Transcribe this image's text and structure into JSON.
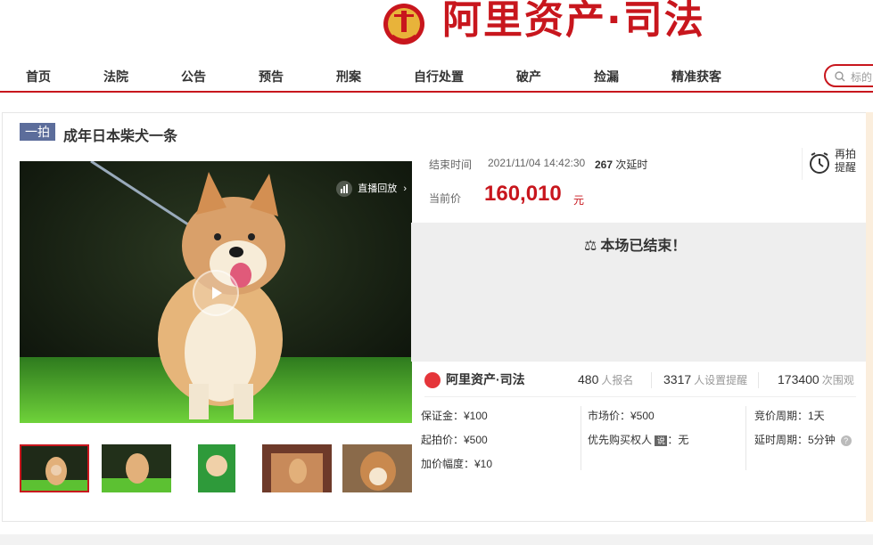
{
  "header": {
    "brand": "阿里资产·司法"
  },
  "nav": {
    "items": [
      "首页",
      "法院",
      "公告",
      "预告",
      "刑案",
      "自行处置",
      "破产",
      "捡漏",
      "精准获客"
    ],
    "search_placeholder": "标的"
  },
  "lot": {
    "badge": "一拍",
    "title": "成年日本柴犬一条",
    "replay_label": "直播回放",
    "end_time_label": "结束时间",
    "end_time": "2021/11/04 14:42:30",
    "delay_count": "267",
    "delay_suffix": "次延时",
    "current_price_label": "当前价",
    "current_price": "160,010",
    "price_unit": "元",
    "again_line1": "再拍",
    "again_line2": "提醒",
    "ended_text": "本场已结束！"
  },
  "stats": {
    "logo_text": "阿里资产·司法",
    "signups": "480",
    "signups_label": "人报名",
    "reminders": "3317",
    "reminders_label": "人设置提醒",
    "views": "173400",
    "views_label": "次围观"
  },
  "details": {
    "deposit": "保证金：¥100",
    "start_price": "起拍价：¥500",
    "increment": "加价幅度：¥10",
    "market_price": "市场价：¥500",
    "priority_buyer_label": "优先购买权人",
    "priority_tag": "说",
    "priority_buyer_value": "：无",
    "bid_period": "竞价周期：1天",
    "delay_period": "延时周期：5分钟"
  },
  "thumbnails": [
    {
      "label": "thumb-1",
      "bg": "#3a5a2e"
    },
    {
      "label": "thumb-2",
      "bg": "#4a6a36"
    },
    {
      "label": "thumb-3",
      "bg": "#2f8f3f"
    },
    {
      "label": "thumb-4",
      "bg": "#8a5a3a"
    },
    {
      "label": "thumb-5",
      "bg": "#7a5a44"
    }
  ],
  "colors": {
    "brand_red": "#c8161d",
    "badge_blue": "#5c6d9b",
    "ended_bg": "#eeeeee"
  }
}
